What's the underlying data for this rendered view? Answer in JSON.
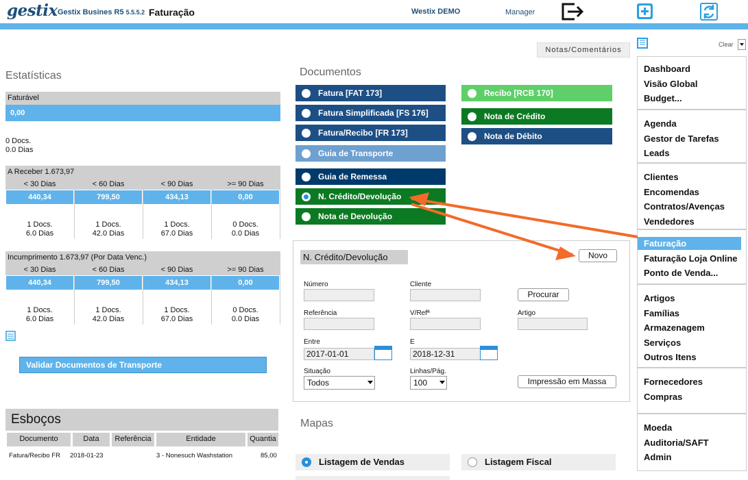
{
  "header": {
    "logo": "gestix",
    "app_name": "Gestix Busines R5",
    "version": "5.5.5.2",
    "module": "Faturação",
    "company": "Westix DEMO",
    "role": "Manager"
  },
  "notes_tab": "Notas/Comentários",
  "clear_label": "Clear",
  "estatisticas": {
    "title": "Estatísticas",
    "faturavel_label": "Faturável",
    "faturavel_value": "0,00",
    "faturavel_docs": "0 Docs.",
    "faturavel_dias": "0.0 Dias",
    "a_receber": {
      "label": "A Receber 1.673,97",
      "columns": [
        "< 30 Dias",
        "< 60 Dias",
        "< 90 Dias",
        ">= 90 Dias"
      ],
      "values": [
        "440,34",
        "799,50",
        "434,13",
        "0,00"
      ],
      "docs": [
        "1 Docs.",
        "1 Docs.",
        "1 Docs.",
        "0 Docs."
      ],
      "dias": [
        "6.0 Dias",
        "42.0 Dias",
        "67.0 Dias",
        "0.0 Dias"
      ]
    },
    "incumprimento": {
      "label": "Incumprimento 1.673,97 (Por Data Venc.)",
      "columns": [
        "< 30 Dias",
        "< 60 Dias",
        "< 90 Dias",
        ">= 90 Dias"
      ],
      "values": [
        "440,34",
        "799,50",
        "434,13",
        "0,00"
      ],
      "docs": [
        "1 Docs.",
        "1 Docs.",
        "1 Docs.",
        "0 Docs."
      ],
      "dias": [
        "6.0 Dias",
        "42.0 Dias",
        "67.0 Dias",
        "0.0 Dias"
      ]
    },
    "validar_button": "Validar Documentos de Transporte"
  },
  "esbocos": {
    "title": "Esboços",
    "columns": [
      "Documento",
      "Data",
      "Referência",
      "Entidade",
      "Quantia"
    ],
    "rows": [
      [
        "Fatura/Recibo FR",
        "2018-01-23",
        "",
        "3 - Nonesuch Washstation",
        "85,00"
      ]
    ]
  },
  "documentos": {
    "title": "Documentos",
    "left": [
      {
        "label": "Fatura [FAT 173]",
        "color": "#1d4f85"
      },
      {
        "label": "Fatura Simplificada [FS 176]",
        "color": "#1d4f85"
      },
      {
        "label": "Fatura/Recibo [FR 173]",
        "color": "#1d4f85"
      },
      {
        "label": "Guia de Transporte",
        "color": "#6ea0d0"
      },
      {
        "label": "Guia de Remessa",
        "color": "#003a6b"
      },
      {
        "label": "N. Crédito/Devolução",
        "color": "#0c7a22",
        "selected": true
      },
      {
        "label": "Nota de Devolução",
        "color": "#0c7a22"
      }
    ],
    "right": [
      {
        "label": "Recibo [RCB 170]",
        "color": "#5fcf69"
      },
      {
        "label": "Nota de Crédito",
        "color": "#0c7a22"
      },
      {
        "label": "Nota de Débito",
        "color": "#1d4f85"
      }
    ]
  },
  "filter": {
    "title": "N. Crédito/Devolução",
    "novo": "Novo",
    "numero_label": "Número",
    "cliente_label": "Cliente",
    "procurar": "Procurar",
    "referencia_label": "Referência",
    "vref_label": "V/Refª",
    "artigo_label": "Artigo",
    "entre_label": "Entre",
    "entre_value": "2017-01-01",
    "e_label": "E",
    "e_value": "2018-12-31",
    "situacao_label": "Situação",
    "situacao_value": "Todos",
    "linhas_label": "Linhas/Pág.",
    "linhas_value": "100",
    "impressao": "Impressão em Massa"
  },
  "mapas": {
    "title": "Mapas",
    "items": [
      {
        "label": "Listagem de Vendas",
        "selected": true
      },
      {
        "label": "Listagem Fiscal",
        "selected": false
      }
    ]
  },
  "menu": {
    "groups": [
      [
        "Dashboard",
        "Visão Global",
        "Budget..."
      ],
      [
        "Agenda",
        "Gestor de Tarefas",
        "Leads"
      ],
      [
        "Clientes",
        "Encomendas",
        "Contratos/Avenças",
        "Vendedores"
      ],
      [
        "Faturação",
        "Faturação Loja Online",
        "Ponto de Venda..."
      ],
      [
        "Artigos",
        "Famílias",
        "Armazenagem",
        "Serviços",
        "Outros Itens"
      ],
      [
        "Fornecedores",
        "Compras"
      ],
      [
        "Moeda",
        "Auditoria/SAFT",
        "Admin"
      ]
    ],
    "active": "Faturação"
  },
  "colors": {
    "accent": "#5fb3ea",
    "annotation_arrow": "#f26b2a"
  }
}
